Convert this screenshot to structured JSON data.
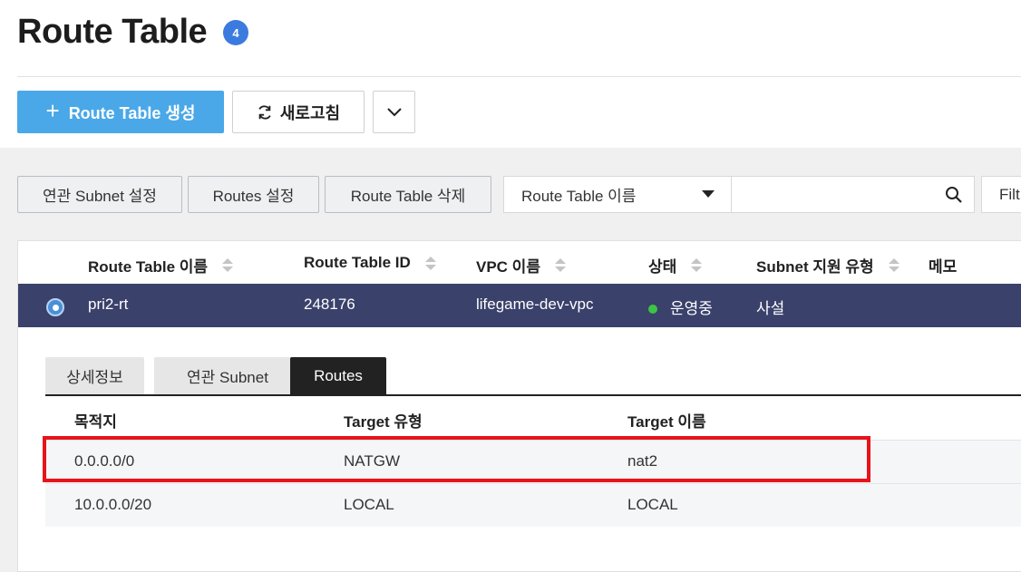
{
  "header": {
    "title": "Route Table",
    "count": "4",
    "create_label": "Route Table 생성",
    "create_plus": "+",
    "refresh_label": "새로고침"
  },
  "toolbar": {
    "subnet_btn": "연관 Subnet 설정",
    "routes_btn": "Routes 설정",
    "delete_btn": "Route Table 삭제",
    "select_value": "Route Table 이름",
    "search_value": "",
    "filter_label": "Filt"
  },
  "table": {
    "columns": [
      "Route Table 이름",
      "Route Table ID",
      "VPC 이름",
      "상태",
      "Subnet 지원 유형",
      "메모"
    ],
    "selected_row": {
      "name": "pri2-rt",
      "id": "248176",
      "vpc": "lifegame-dev-vpc",
      "status": "운영중",
      "subnet_type": "사설",
      "memo": ""
    }
  },
  "detail": {
    "tabs": [
      "상세정보",
      "연관 Subnet",
      "Routes"
    ],
    "active_tab": "Routes",
    "columns": [
      "목적지",
      "Target 유형",
      "Target 이름"
    ],
    "rows": [
      {
        "destination": "0.0.0.0/0",
        "target_type": "NATGW",
        "target_name": "nat2"
      },
      {
        "destination": "10.0.0.0/20",
        "target_type": "LOCAL",
        "target_name": "LOCAL"
      }
    ]
  },
  "colors": {
    "accent": "#4aa8e8",
    "selected_row": "#3a416b",
    "status_running": "#3cc443",
    "highlight": "#e8131a"
  }
}
